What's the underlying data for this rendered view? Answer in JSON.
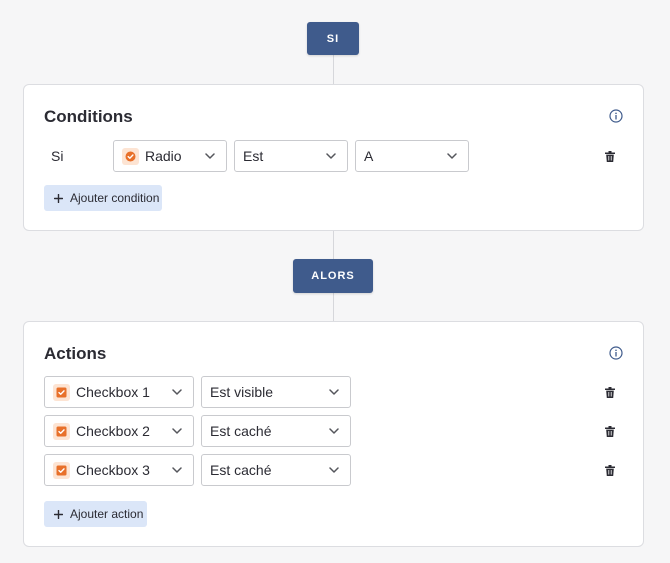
{
  "steps": {
    "if_label": "SI",
    "then_label": "ALORS"
  },
  "conditions": {
    "title": "Conditions",
    "rows": [
      {
        "prefix": "Si",
        "field": "Radio",
        "field_icon": "radio-checked-icon",
        "operator": "Est",
        "value": "A"
      }
    ],
    "add_label": "Ajouter condition"
  },
  "actions": {
    "title": "Actions",
    "rows": [
      {
        "field": "Checkbox 1",
        "field_icon": "checkbox-checked-icon",
        "action": "Est visible"
      },
      {
        "field": "Checkbox 2",
        "field_icon": "checkbox-checked-icon",
        "action": "Est caché"
      },
      {
        "field": "Checkbox 3",
        "field_icon": "checkbox-checked-icon",
        "action": "Est caché"
      }
    ],
    "add_label": "Ajouter action"
  },
  "colors": {
    "step_pill": "#3f5b8c",
    "field_icon_accent": "#e8702a",
    "add_button_bg": "#dbe6f8",
    "info_icon": "#3f5b8c"
  }
}
